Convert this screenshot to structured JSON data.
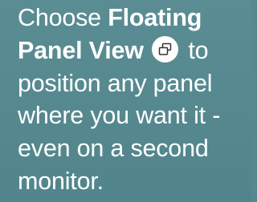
{
  "tip": {
    "part1": "Choose ",
    "bold_text": "Floating Panel View",
    "icon": "floating-panel-icon",
    "part2": " to position any panel where you want it - even on a second monitor."
  },
  "colors": {
    "background": "#56898f",
    "text": "#ffffff",
    "icon_bg": "#ffffff",
    "icon_fg": "#333333"
  }
}
